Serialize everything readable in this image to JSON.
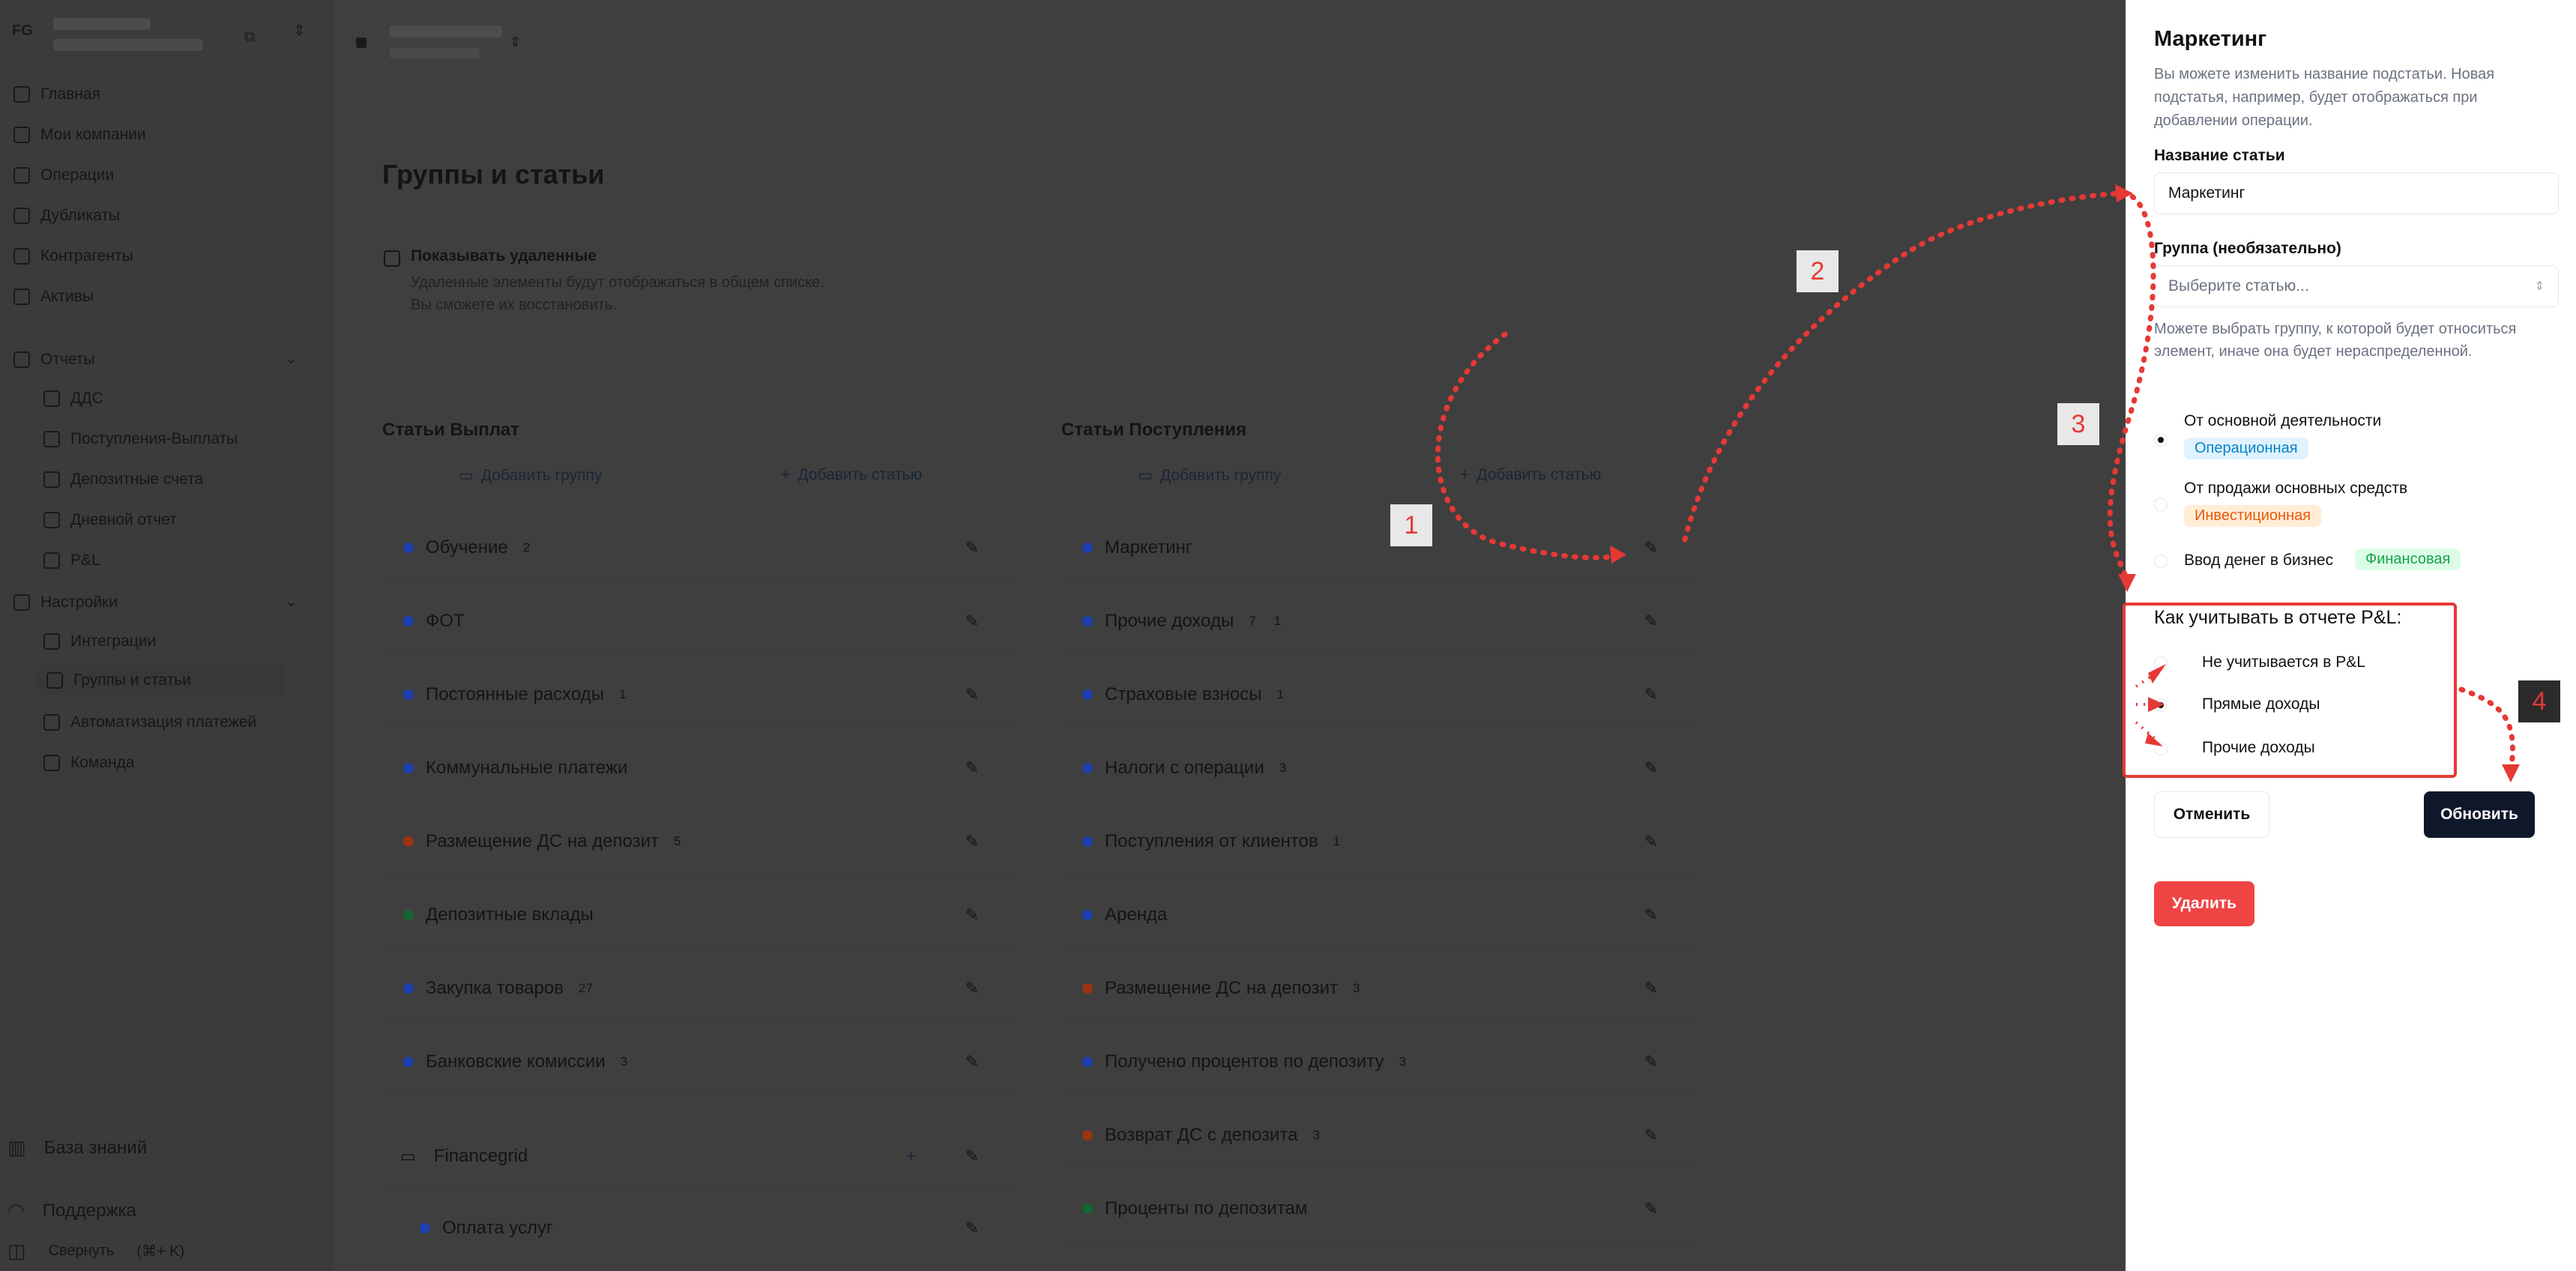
{
  "sidebar": {
    "avatar": "FG",
    "nav": [
      {
        "label": "Главная",
        "icon": "home-icon"
      },
      {
        "label": "Мои компании",
        "icon": "briefcase-icon"
      },
      {
        "label": "Операции",
        "icon": "document-icon"
      },
      {
        "label": "Дубликаты",
        "icon": "copy-icon"
      },
      {
        "label": "Контрагенты",
        "icon": "building-icon"
      },
      {
        "label": "Активы",
        "icon": "wallet-icon"
      }
    ],
    "reports": {
      "label": "Отчеты",
      "items": [
        "ДДС",
        "Поступления-Выплаты",
        "Депозитные счета",
        "Дневной отчет",
        "P&L"
      ]
    },
    "settings": {
      "label": "Настройки",
      "items": [
        "Интеграции",
        "Группы и статьи",
        "Автоматизация платежей",
        "Команда"
      ]
    },
    "bottom": {
      "knowledge": "База знаний",
      "support": "Поддержка",
      "collapse": "Свернуть",
      "collapse_shortcut": "(⌘+ K)"
    }
  },
  "main": {
    "title": "Группы и статьи",
    "show_deleted_label": "Показывать удаленные",
    "show_deleted_hint1": "Удаленные элементы будут отображаться в общем списке.",
    "show_deleted_hint2": "Вы сможете их восстановить.",
    "payments": {
      "title": "Статьи Выплат",
      "add_group": "Добавить группу",
      "add_item": "Добавить статью",
      "rows": [
        {
          "name": "Обучение",
          "count": "2",
          "color": "#1e40af"
        },
        {
          "name": "ФОТ",
          "count": "",
          "color": "#1e40af"
        },
        {
          "name": "Постоянные расходы",
          "count": "1",
          "color": "#1e40af"
        },
        {
          "name": "Коммунальные платежи",
          "count": "",
          "color": "#1e40af"
        },
        {
          "name": "Размещение ДС на депозит",
          "count": "5",
          "color": "#9a3412"
        },
        {
          "name": "Депозитные вклады",
          "count": "",
          "color": "#166534"
        },
        {
          "name": "Закупка товаров",
          "count": "27",
          "color": "#1e40af"
        },
        {
          "name": "Банковские комиссии",
          "count": "3",
          "color": "#1e40af"
        }
      ],
      "group": {
        "name": "Financegrid"
      },
      "group_row": {
        "name": "Оплата услуг",
        "color": "#1e40af"
      }
    },
    "receipts": {
      "title": "Статьи Поступления",
      "add_group": "Добавить группу",
      "add_item": "Добавить статью",
      "rows": [
        {
          "name": "Маркетинг",
          "count": "",
          "count2": "",
          "color": "#1e40af"
        },
        {
          "name": "Прочие доходы",
          "count": "7",
          "count2": "1",
          "color": "#1e40af"
        },
        {
          "name": "Страховые взносы",
          "count": "1",
          "count2": "",
          "color": "#1e40af"
        },
        {
          "name": "Налоги с операции",
          "count": "3",
          "count2": "",
          "color": "#1e40af"
        },
        {
          "name": "Поступления от клиентов",
          "count": "1",
          "count2": "",
          "color": "#1e40af"
        },
        {
          "name": "Аренда",
          "count": "",
          "count2": "",
          "color": "#1e40af"
        },
        {
          "name": "Размещение ДС на депозит",
          "count": "3",
          "count2": "",
          "color": "#9a3412"
        },
        {
          "name": "Получено процентов по депозиту",
          "count": "3",
          "count2": "",
          "color": "#1e40af"
        },
        {
          "name": "Возврат ДС с депозита",
          "count": "3",
          "count2": "",
          "color": "#9a3412"
        },
        {
          "name": "Проценты по депозитам",
          "count": "",
          "count2": "",
          "color": "#166534"
        }
      ]
    }
  },
  "drawer": {
    "title": "Маркетинг",
    "description": "Вы можете изменить название подстатьи. Новая подстатья, например, будет отображаться при добавлении операции.",
    "name_label": "Название статьи",
    "name_value": "Маркетинг",
    "group_label": "Группа (необязательно)",
    "group_placeholder": "Выберите статью...",
    "group_hint": "Можете выбрать группу, к которой будет относиться элемент, иначе она будет нераспределенной.",
    "activity": [
      {
        "label": "От основной деятельности",
        "badge": "Операционная",
        "checked": true
      },
      {
        "label": "От продажи основных средств",
        "badge": "Инвестиционная",
        "checked": false
      },
      {
        "label": "Ввод денег в бизнес",
        "badge": "Финансовая",
        "checked": false
      }
    ],
    "pl_title": "Как учитывать в отчете P&L:",
    "pl_options": [
      {
        "label": "Не учитывается в P&L",
        "checked": false
      },
      {
        "label": "Прямые доходы",
        "checked": true
      },
      {
        "label": "Прочие доходы",
        "checked": false
      }
    ],
    "cancel": "Отменить",
    "update": "Обновить",
    "delete": "Удалить"
  },
  "annotations": [
    "1",
    "2",
    "3",
    "4"
  ],
  "colors": {
    "accent_red": "#e53935",
    "update_button": "#0f172a",
    "delete_button": "#ef4444"
  }
}
